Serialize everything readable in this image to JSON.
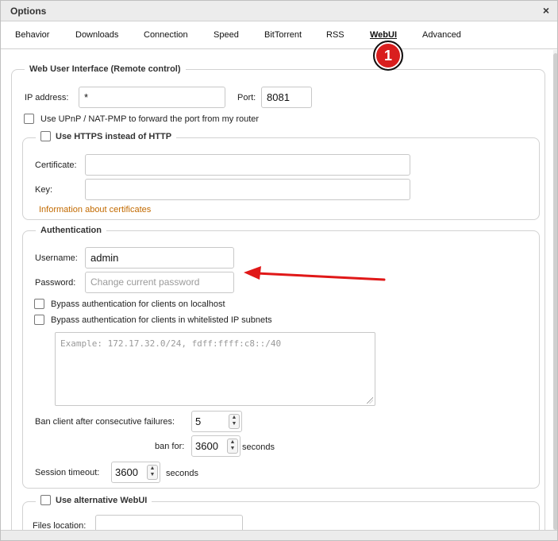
{
  "window": {
    "title": "Options",
    "close_label": "×"
  },
  "tabs": [
    {
      "label": "Behavior"
    },
    {
      "label": "Downloads"
    },
    {
      "label": "Connection"
    },
    {
      "label": "Speed"
    },
    {
      "label": "BitTorrent"
    },
    {
      "label": "RSS"
    },
    {
      "label": "WebUI",
      "active": true
    },
    {
      "label": "Advanced"
    }
  ],
  "badge": {
    "text": "1",
    "color": "#d91e1e"
  },
  "webui": {
    "legend": "Web User Interface (Remote control)",
    "ip_label": "IP address:",
    "ip_value": "*",
    "port_label": "Port:",
    "port_value": "8081",
    "upnp_label": "Use UPnP / NAT-PMP to forward the port from my router"
  },
  "https": {
    "legend": "Use HTTPS instead of HTTP",
    "cert_label": "Certificate:",
    "cert_value": "",
    "key_label": "Key:",
    "key_value": "",
    "info_link": "Information about certificates"
  },
  "auth": {
    "legend": "Authentication",
    "username_label": "Username:",
    "username_value": "admin",
    "password_label": "Password:",
    "password_placeholder": "Change current password",
    "bypass_localhost": "Bypass authentication for clients on localhost",
    "bypass_whitelist": "Bypass authentication for clients in whitelisted IP subnets",
    "whitelist_placeholder": "Example: 172.17.32.0/24, fdff:ffff:c8::/40",
    "ban_label": "Ban client after consecutive failures:",
    "ban_value": "5",
    "banfor_label": "ban for:",
    "banfor_value": "3600",
    "banfor_unit": "seconds",
    "session_label": "Session timeout:",
    "session_value": "3600",
    "session_unit": "seconds"
  },
  "altwebui": {
    "legend": "Use alternative WebUI",
    "files_label": "Files location:",
    "files_value": ""
  },
  "colors": {
    "accent_link": "#c26a00",
    "arrow": "#e01818"
  }
}
